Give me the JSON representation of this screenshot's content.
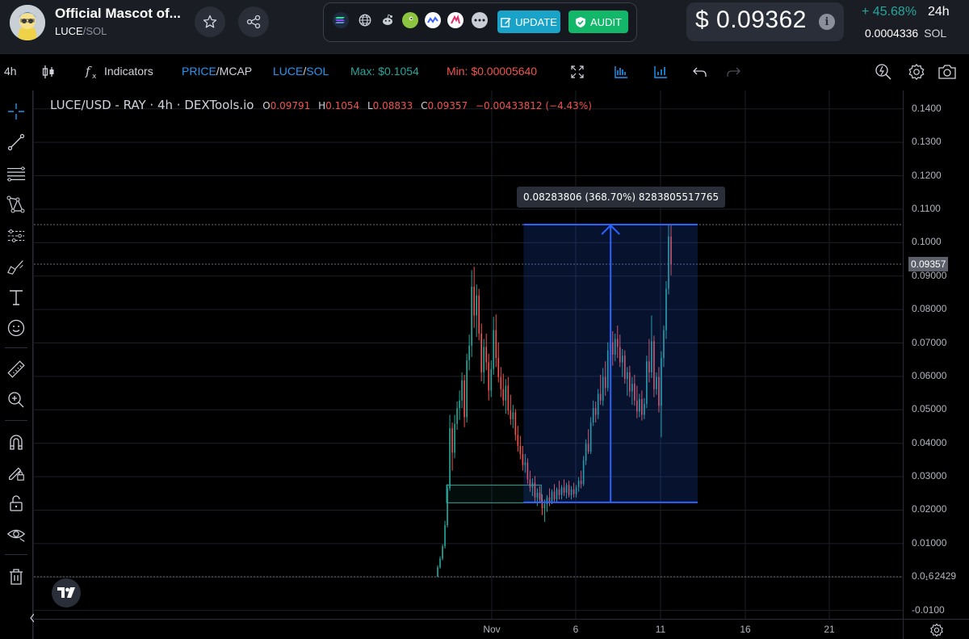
{
  "header": {
    "title": "Official Mascot of...",
    "pair_symbol": "LUCE",
    "pair_separator": "/",
    "pair_quote": "SOL",
    "favorite_icon": "star-icon",
    "share_icon": "share-icon",
    "links": [
      {
        "name": "solana-icon",
        "color": "#5b8fd6"
      },
      {
        "name": "globe-icon",
        "color": "#c9cdd6"
      },
      {
        "name": "reddit-icon",
        "color": "#c9cdd6"
      },
      {
        "name": "coingecko-icon",
        "color": "#8bc53f"
      },
      {
        "name": "coinmarketcap-icon",
        "color": "#3861fb"
      },
      {
        "name": "dexscreener-icon",
        "color": "#e1306c"
      },
      {
        "name": "more-icon",
        "color": "#c9cdd6"
      }
    ],
    "update_label": "UPDATE",
    "audit_label": "AUDIT",
    "price_usd": "$ 0.09362",
    "change_24h": "+ 45.68%",
    "change_period": "24h",
    "price_sol": "0.0004336",
    "price_sol_unit": "SOL",
    "colors": {
      "update": "#1aa3c9",
      "audit": "#12b76a",
      "positive": "#26a69a",
      "negative": "#ef5350"
    }
  },
  "toolbar": {
    "interval": "4h",
    "indicators_label": "Indicators",
    "price_label": "PRICE",
    "mcap_label": "/MCAP",
    "pair_sym": "LUCE",
    "pair_sep": "/",
    "pair_quote": "SOL",
    "max_label": "Max: $0.1054",
    "min_label": "Min: $0.00005640"
  },
  "legend": {
    "pair": "LUCE/USD - RAY · 4h · DEXTools.io",
    "open_key": "O",
    "open": "0.09791",
    "high_key": "H",
    "high": "0.1054",
    "low_key": "L",
    "low": "0.08833",
    "close_key": "C",
    "close": "0.09357",
    "change": "−0.00433812 (−4.43%)"
  },
  "measure": {
    "label": "0.08283806 (368.70%) 8283805517765"
  },
  "price_axis": {
    "ticks": [
      "0.1400",
      "0.1300",
      "0.1200",
      "0.1100",
      "0.1000",
      "0.09000",
      "0.08000",
      "0.07000",
      "0.06000",
      "0.05000",
      "0.04000",
      "0.03000",
      "0.02000",
      "0.01000",
      "0.0₁6 2429",
      "-0.0100"
    ],
    "current_label": "0.09357"
  },
  "time_axis": {
    "ticks": [
      "Nov",
      "6",
      "11",
      "16",
      "21"
    ]
  },
  "chart_data": {
    "type": "candlestick",
    "title": "LUCE/USD - RAY · 4h · DEXTools.io",
    "ylim": [
      -0.0125,
      0.1455
    ],
    "x": [
      "Nov",
      "6",
      "11",
      "16",
      "21"
    ],
    "current_price": 0.09357,
    "measure_range": {
      "from": 0.02232,
      "to": 0.1054,
      "change": "0.08283806 (368.70%)"
    },
    "series": [
      {
        "name": "LUCE/USD",
        "candles": [
          [
            6e-05,
            0.0035,
            5e-05,
            0.0029
          ],
          [
            0.0029,
            0.0062,
            0.0025,
            0.0055
          ],
          [
            0.0055,
            0.0098,
            0.005,
            0.0092
          ],
          [
            0.0092,
            0.0168,
            0.0085,
            0.0155
          ],
          [
            0.0155,
            0.0278,
            0.0148,
            0.0265
          ],
          [
            0.0265,
            0.0485,
            0.0258,
            0.0445
          ],
          [
            0.0445,
            0.0462,
            0.0318,
            0.0372
          ],
          [
            0.0372,
            0.0485,
            0.0355,
            0.0458
          ],
          [
            0.0458,
            0.0525,
            0.044,
            0.0505
          ],
          [
            0.0505,
            0.0558,
            0.047,
            0.0528
          ],
          [
            0.0528,
            0.0612,
            0.0505,
            0.0588
          ],
          [
            0.0588,
            0.0605,
            0.0448,
            0.0478
          ],
          [
            0.0478,
            0.0668,
            0.0462,
            0.0648
          ],
          [
            0.0648,
            0.0725,
            0.0618,
            0.0692
          ],
          [
            0.0692,
            0.0918,
            0.0658,
            0.0868
          ],
          [
            0.0868,
            0.0928,
            0.0745,
            0.0782
          ],
          [
            0.0782,
            0.0875,
            0.0718,
            0.0842
          ],
          [
            0.0842,
            0.0862,
            0.0708,
            0.0728
          ],
          [
            0.0728,
            0.0758,
            0.0585,
            0.0612
          ],
          [
            0.0612,
            0.0712,
            0.0578,
            0.0688
          ],
          [
            0.0688,
            0.0728,
            0.0618,
            0.0642
          ],
          [
            0.0642,
            0.0668,
            0.0528,
            0.0558
          ],
          [
            0.0558,
            0.0648,
            0.0538,
            0.0622
          ],
          [
            0.0622,
            0.0778,
            0.0605,
            0.0738
          ],
          [
            0.0738,
            0.0785,
            0.0628,
            0.0655
          ],
          [
            0.0655,
            0.0702,
            0.0582,
            0.0598
          ],
          [
            0.0598,
            0.0628,
            0.0538,
            0.0562
          ],
          [
            0.0562,
            0.0608,
            0.0512,
            0.0528
          ],
          [
            0.0528,
            0.0592,
            0.0488,
            0.0572
          ],
          [
            0.0572,
            0.0598,
            0.0485,
            0.0498
          ],
          [
            0.0498,
            0.0545,
            0.0455,
            0.0472
          ],
          [
            0.0472,
            0.0515,
            0.0445,
            0.0492
          ],
          [
            0.0492,
            0.0502,
            0.0408,
            0.0425
          ],
          [
            0.0425,
            0.0452,
            0.0375,
            0.0392
          ],
          [
            0.0392,
            0.0422,
            0.0352,
            0.0368
          ],
          [
            0.0368,
            0.0392,
            0.0318,
            0.0335
          ],
          [
            0.0335,
            0.0368,
            0.0312,
            0.0342
          ],
          [
            0.0342,
            0.0355,
            0.0278,
            0.0292
          ],
          [
            0.0292,
            0.0318,
            0.0255,
            0.0268
          ],
          [
            0.0268,
            0.0295,
            0.0242,
            0.0282
          ],
          [
            0.0282,
            0.0302,
            0.0225,
            0.0238
          ],
          [
            0.0238,
            0.0265,
            0.0212,
            0.0252
          ],
          [
            0.0252,
            0.0272,
            0.0225,
            0.0232
          ],
          [
            0.0232,
            0.0248,
            0.0185,
            0.0205
          ],
          [
            0.0205,
            0.0232,
            0.0165,
            0.0218
          ],
          [
            0.0218,
            0.0245,
            0.0195,
            0.0238
          ],
          [
            0.0238,
            0.0265,
            0.0212,
            0.0225
          ],
          [
            0.0225,
            0.0262,
            0.0218,
            0.0255
          ],
          [
            0.0255,
            0.0278,
            0.0225,
            0.0232
          ],
          [
            0.0232,
            0.0268,
            0.0222,
            0.0262
          ],
          [
            0.0262,
            0.0288,
            0.0232,
            0.0245
          ],
          [
            0.0245,
            0.0275,
            0.0232,
            0.0268
          ],
          [
            0.0268,
            0.0292,
            0.0242,
            0.0252
          ],
          [
            0.0252,
            0.0282,
            0.0235,
            0.0275
          ],
          [
            0.0275,
            0.0288,
            0.0238,
            0.0245
          ],
          [
            0.0245,
            0.0272,
            0.0232,
            0.0262
          ],
          [
            0.0262,
            0.0282,
            0.0238,
            0.0248
          ],
          [
            0.0248,
            0.0275,
            0.0238,
            0.0268
          ],
          [
            0.0268,
            0.0298,
            0.0255,
            0.0288
          ],
          [
            0.0288,
            0.0318,
            0.0265,
            0.0278
          ],
          [
            0.0278,
            0.0362,
            0.0272,
            0.0348
          ],
          [
            0.0348,
            0.0412,
            0.0335,
            0.0398
          ],
          [
            0.0398,
            0.0442,
            0.0368,
            0.0375
          ],
          [
            0.0375,
            0.0478,
            0.0368,
            0.0462
          ],
          [
            0.0462,
            0.0528,
            0.0452,
            0.0505
          ],
          [
            0.0505,
            0.0525,
            0.0462,
            0.0485
          ],
          [
            0.0485,
            0.0562,
            0.0472,
            0.0548
          ],
          [
            0.0548,
            0.0605,
            0.0515,
            0.0528
          ],
          [
            0.0528,
            0.0625,
            0.0512,
            0.0598
          ],
          [
            0.0598,
            0.0645,
            0.0542,
            0.0565
          ],
          [
            0.0565,
            0.0702,
            0.0555,
            0.0678
          ],
          [
            0.0678,
            0.0852,
            0.0648,
            0.0702
          ],
          [
            0.0702,
            0.0735,
            0.0632,
            0.0665
          ],
          [
            0.0665,
            0.0728,
            0.0645,
            0.0712
          ],
          [
            0.0712,
            0.0752,
            0.0655,
            0.0688
          ],
          [
            0.0688,
            0.0725,
            0.0628,
            0.0642
          ],
          [
            0.0642,
            0.0682,
            0.0598,
            0.0662
          ],
          [
            0.0662,
            0.0678,
            0.0578,
            0.0592
          ],
          [
            0.0592,
            0.0628,
            0.0542,
            0.0612
          ],
          [
            0.0612,
            0.0632,
            0.0538,
            0.0555
          ],
          [
            0.0555,
            0.0598,
            0.0515,
            0.0578
          ],
          [
            0.0578,
            0.0605,
            0.0512,
            0.0528
          ],
          [
            0.0528,
            0.0572,
            0.0475,
            0.0495
          ],
          [
            0.0495,
            0.0548,
            0.0478,
            0.0532
          ],
          [
            0.0532,
            0.0558,
            0.0468,
            0.0485
          ],
          [
            0.0485,
            0.0535,
            0.0472,
            0.0518
          ],
          [
            0.0518,
            0.0662,
            0.0505,
            0.0645
          ],
          [
            0.0645,
            0.0712,
            0.0582,
            0.0612
          ],
          [
            0.0612,
            0.0782,
            0.0595,
            0.0705
          ],
          [
            0.0705,
            0.0722,
            0.0538,
            0.0562
          ],
          [
            0.0562,
            0.0612,
            0.0545,
            0.0598
          ],
          [
            0.0598,
            0.0628,
            0.0492,
            0.0512
          ],
          [
            0.0512,
            0.0675,
            0.0418,
            0.0655
          ],
          [
            0.0655,
            0.0752,
            0.0628,
            0.0738
          ],
          [
            0.0738,
            0.0885,
            0.0712,
            0.0862
          ],
          [
            0.0862,
            0.1054,
            0.0845,
            0.1018
          ],
          [
            0.1018,
            0.1054,
            0.0902,
            0.0936
          ]
        ]
      }
    ]
  }
}
